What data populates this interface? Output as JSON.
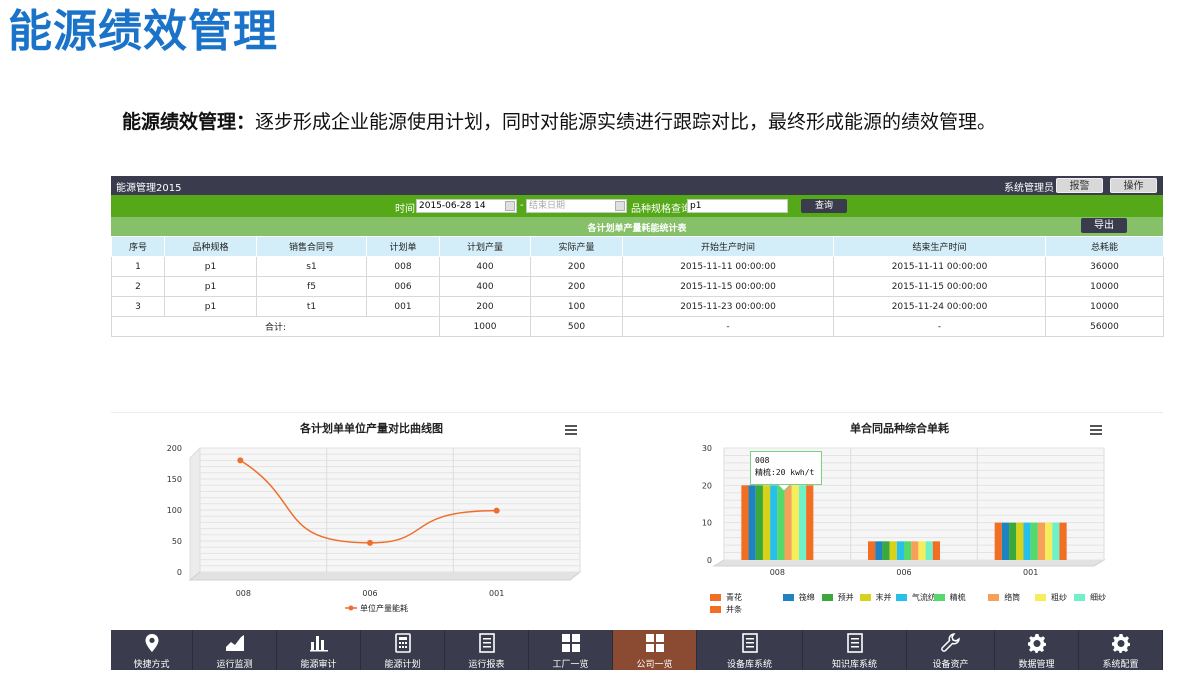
{
  "page": {
    "title": "能源绩效管理",
    "intro_bold": "能源绩效管理：",
    "intro_text": "逐步形成企业能源使用计划，同时对能源实绩进行跟踪对比，最终形成能源的绩效管理。"
  },
  "app": {
    "name": "能源管理2015",
    "user": "系统管理员",
    "btn_alarm": "报警",
    "btn_ops": "操作"
  },
  "filter": {
    "time_label": "时间:",
    "start_date": "2015-06-28 14",
    "dash": "-",
    "end_placeholder": "结束日期",
    "spec_label": "品种规格查询:",
    "spec_value": "p1",
    "query_label": "查询"
  },
  "table": {
    "title": "各计划单产量耗能统计表",
    "export_label": "导出",
    "headers": [
      "序号",
      "品种规格",
      "销售合同号",
      "计划单",
      "计划产量",
      "实际产量",
      "开始生产时间",
      "结束生产时间",
      "总耗能"
    ],
    "rows": [
      [
        "1",
        "p1",
        "s1",
        "008",
        "400",
        "200",
        "2015-11-11 00:00:00",
        "2015-11-11 00:00:00",
        "36000"
      ],
      [
        "2",
        "p1",
        "f5",
        "006",
        "400",
        "200",
        "2015-11-15 00:00:00",
        "2015-11-15 00:00:00",
        "10000"
      ],
      [
        "3",
        "p1",
        "t1",
        "001",
        "200",
        "100",
        "2015-11-23 00:00:00",
        "2015-11-24 00:00:00",
        "10000"
      ]
    ],
    "total_row": [
      "合计:",
      "1000",
      "500",
      "-",
      "-",
      "56000"
    ]
  },
  "chart_data": [
    {
      "type": "line",
      "title": "各计划单单位产量对比曲线图",
      "categories": [
        "008",
        "006",
        "001"
      ],
      "series": [
        {
          "name": "单位产量能耗",
          "values": [
            180,
            47,
            99
          ],
          "color": "#ee6e2b"
        }
      ],
      "ylim": [
        0,
        200
      ],
      "yticks": [
        0,
        50,
        100,
        150,
        200
      ],
      "grid": true,
      "legend": "bottom"
    },
    {
      "type": "bar",
      "title": "单合同品种综合单耗",
      "categories": [
        "008",
        "006",
        "001"
      ],
      "series": [
        {
          "name": "青花",
          "values": [
            20,
            5,
            10
          ],
          "color": "#f26e22"
        },
        {
          "name": "筏绵",
          "values": [
            20,
            5,
            10
          ],
          "color": "#1f82c1"
        },
        {
          "name": "预并",
          "values": [
            20,
            5,
            10
          ],
          "color": "#3aa83a"
        },
        {
          "name": "末并",
          "values": [
            20,
            5,
            10
          ],
          "color": "#d9d21a"
        },
        {
          "name": "气流纺",
          "values": [
            20,
            5,
            10
          ],
          "color": "#28c0e8"
        },
        {
          "name": "精梳",
          "values": [
            20,
            5,
            10
          ],
          "color": "#55d96b"
        },
        {
          "name": "络筒",
          "values": [
            20,
            5,
            10
          ],
          "color": "#f7a05a"
        },
        {
          "name": "粗纱",
          "values": [
            20,
            5,
            10
          ],
          "color": "#f5ee5a"
        },
        {
          "name": "细纱",
          "values": [
            20,
            5,
            10
          ],
          "color": "#6ff0c8"
        },
        {
          "name": "并条",
          "values": [
            20,
            5,
            10
          ],
          "color": "#f26e22"
        }
      ],
      "ylim": [
        0,
        30
      ],
      "yticks": [
        0,
        10,
        20,
        30
      ],
      "grid": true,
      "legend": "bottom-left",
      "tooltip": {
        "line1": "008",
        "line2": "精梳:20 kwh/t"
      }
    }
  ],
  "nav": {
    "items": [
      {
        "label": "快捷方式",
        "icon": "pin-icon"
      },
      {
        "label": "运行监测",
        "icon": "area-chart-icon"
      },
      {
        "label": "能源审计",
        "icon": "bar-chart-icon"
      },
      {
        "label": "能源计划",
        "icon": "calculator-icon"
      },
      {
        "label": "运行报表",
        "icon": "document-icon"
      },
      {
        "label": "工厂一览",
        "icon": "grid-icon"
      },
      {
        "label": "公司一览",
        "icon": "grid-icon"
      },
      {
        "label": "设备库系统",
        "icon": "document-icon"
      },
      {
        "label": "知识库系统",
        "icon": "document-icon"
      },
      {
        "label": "设备资产",
        "icon": "wrench-icon"
      },
      {
        "label": "数据管理",
        "icon": "gear-icon"
      },
      {
        "label": "系统配置",
        "icon": "gear-icon"
      }
    ],
    "active_index": 6
  }
}
